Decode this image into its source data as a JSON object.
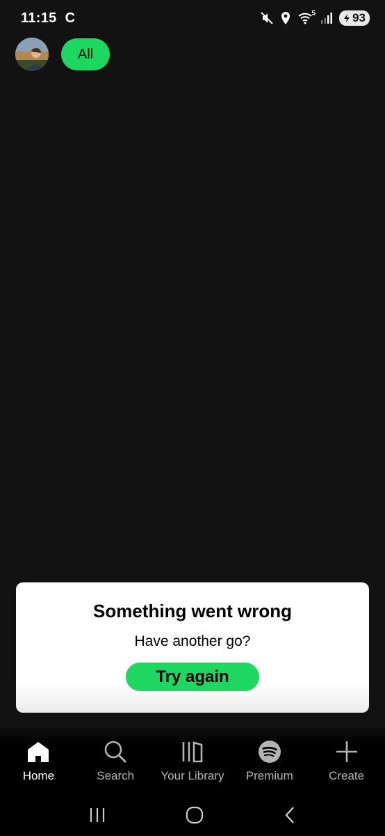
{
  "status_bar": {
    "time": "11:15",
    "carrier_glyph": "C",
    "wifi_band": "5",
    "battery": "93",
    "icons": [
      "mute-icon",
      "location-icon",
      "wifi-icon",
      "signal-icon",
      "battery-icon"
    ]
  },
  "filters": {
    "chips": [
      {
        "label": "All",
        "selected": true
      }
    ]
  },
  "error": {
    "title": "Something went wrong",
    "subtitle": "Have another go?",
    "button": "Try again"
  },
  "nav": {
    "items": [
      {
        "label": "Home",
        "icon": "home-icon",
        "active": true
      },
      {
        "label": "Search",
        "icon": "search-icon",
        "active": false
      },
      {
        "label": "Your Library",
        "icon": "library-icon",
        "active": false
      },
      {
        "label": "Premium",
        "icon": "spotify-icon",
        "active": false
      },
      {
        "label": "Create",
        "icon": "plus-icon",
        "active": false
      }
    ]
  },
  "system_nav": [
    "recents-icon",
    "home-circle-icon",
    "back-icon"
  ],
  "colors": {
    "background": "#121212",
    "accent": "#1ed760",
    "nav_inactive": "#b3b3b3",
    "card": "#ffffff"
  }
}
